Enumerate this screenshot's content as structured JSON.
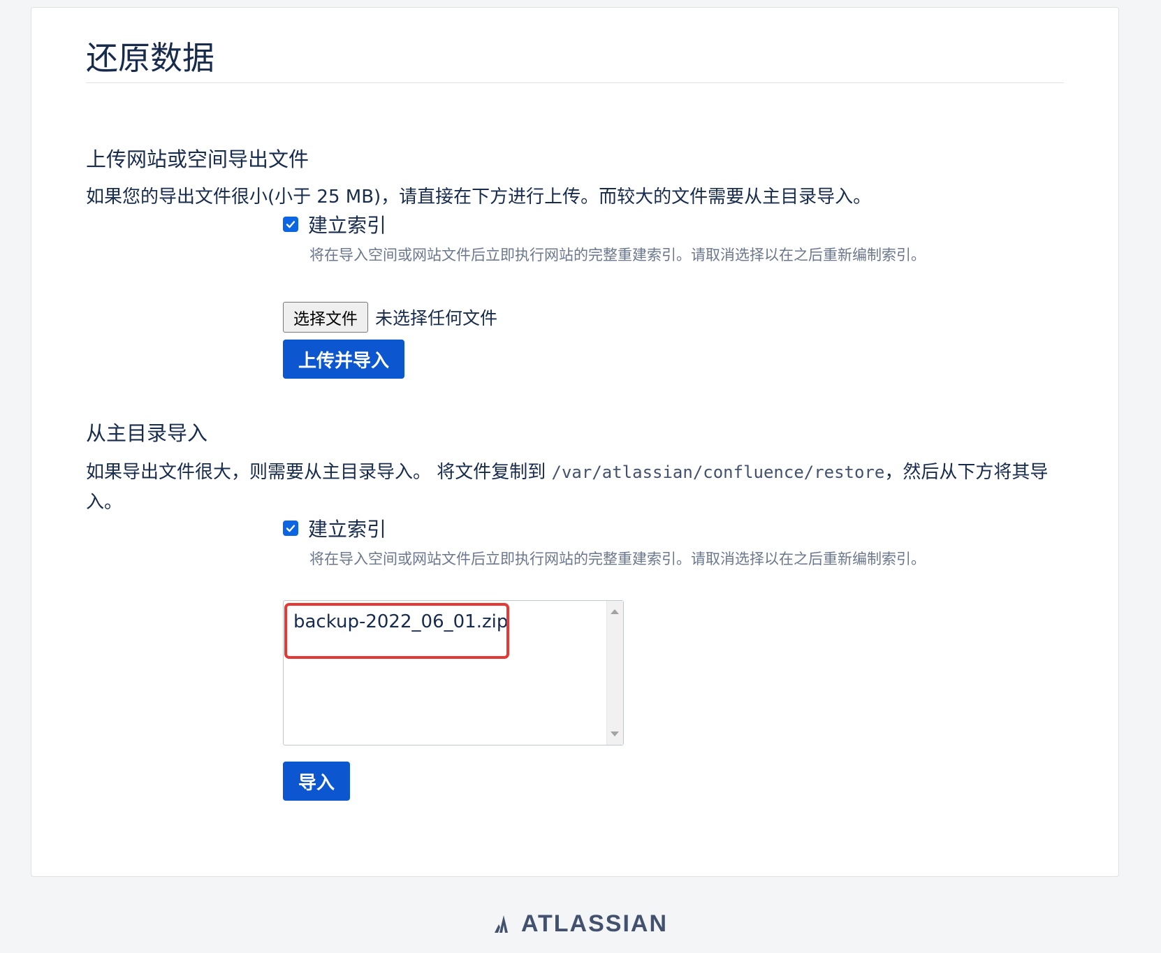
{
  "page": {
    "title": "还原数据"
  },
  "upload_section": {
    "heading": "上传网站或空间导出文件",
    "description": "如果您的导出文件很小(小于 25 MB)，请直接在下方进行上传。而较大的文件需要从主目录导入。",
    "build_index_label": "建立索引",
    "build_index_checked": true,
    "build_index_help": "将在导入空间或网站文件后立即执行网站的完整重建索引。请取消选择以在之后重新编制索引。",
    "file_button_label": "选择文件",
    "file_status": "未选择任何文件",
    "submit_label": "上传并导入"
  },
  "home_section": {
    "heading": "从主目录导入",
    "description_before": "如果导出文件很大，则需要从主目录导入。 将文件复制到 ",
    "restore_path": "/var/atlassian/confluence/restore",
    "description_after": "，然后从下方将其导入。",
    "build_index_label": "建立索引",
    "build_index_checked": true,
    "build_index_help": "将在导入空间或网站文件后立即执行网站的完整重建索引。请取消选择以在之后重新编制索引。",
    "files": [
      "backup-2022_06_01.zip"
    ],
    "submit_label": "导入"
  },
  "footer": {
    "brand": "ATLASSIAN"
  },
  "colors": {
    "primary": "#0c57d0",
    "checkbox": "#0c66e4",
    "highlight": "#e53935",
    "page_bg": "#f4f5f7"
  }
}
